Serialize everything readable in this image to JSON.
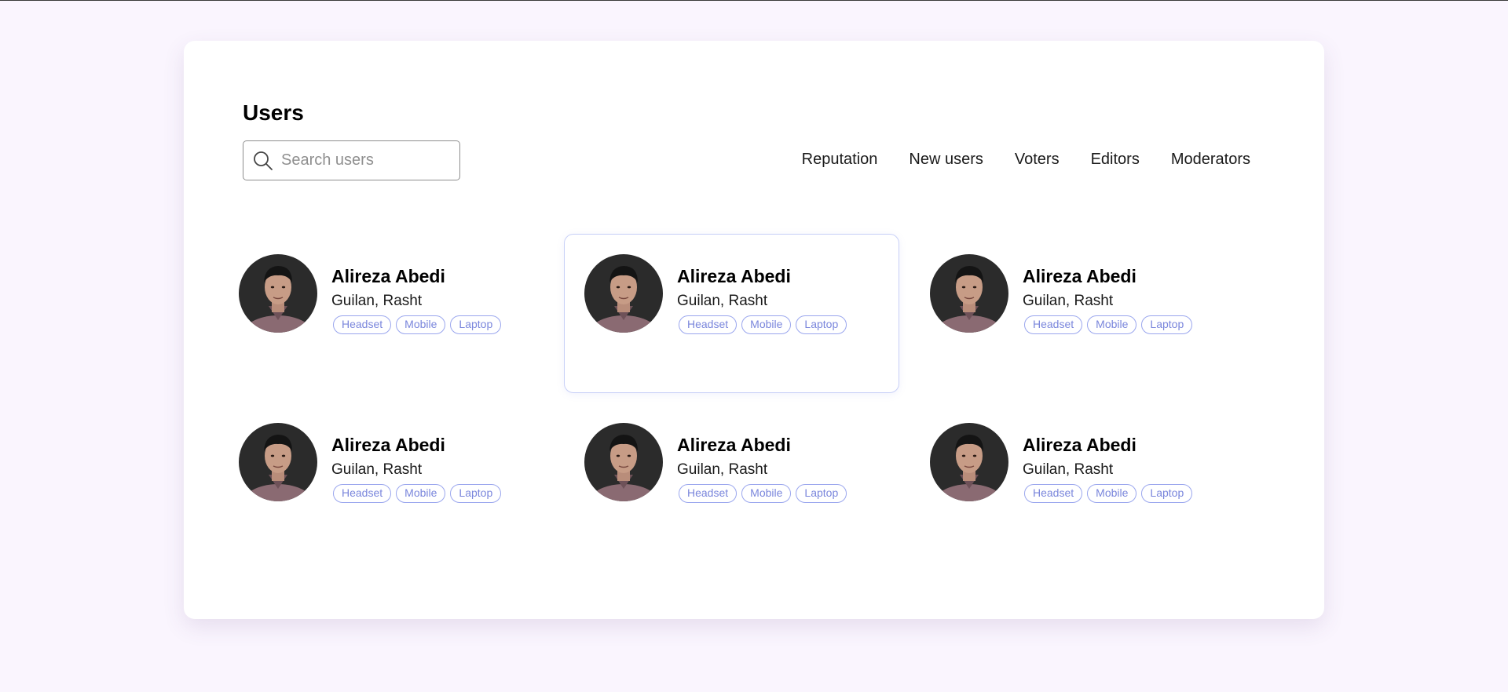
{
  "page": {
    "title": "Users"
  },
  "search": {
    "placeholder": "Search users",
    "value": "",
    "icon": "search-icon"
  },
  "filters": [
    {
      "label": "Reputation"
    },
    {
      "label": "New users"
    },
    {
      "label": "Voters"
    },
    {
      "label": "Editors"
    },
    {
      "label": "Moderators"
    }
  ],
  "colors": {
    "background": "#faf5fe",
    "panel": "#ffffff",
    "tag_border": "#9aa6ee",
    "tag_text": "#7a86dc",
    "highlight_border": "#c8d0f7"
  },
  "users": [
    {
      "name": "Alireza Abedi",
      "location": "Guilan, Rasht",
      "tags": [
        "Headset",
        "Mobile",
        "Laptop"
      ],
      "highlighted": false
    },
    {
      "name": "Alireza Abedi",
      "location": "Guilan, Rasht",
      "tags": [
        "Headset",
        "Mobile",
        "Laptop"
      ],
      "highlighted": true
    },
    {
      "name": "Alireza Abedi",
      "location": "Guilan, Rasht",
      "tags": [
        "Headset",
        "Mobile",
        "Laptop"
      ],
      "highlighted": false
    },
    {
      "name": "Alireza Abedi",
      "location": "Guilan, Rasht",
      "tags": [
        "Headset",
        "Mobile",
        "Laptop"
      ],
      "highlighted": false
    },
    {
      "name": "Alireza Abedi",
      "location": "Guilan, Rasht",
      "tags": [
        "Headset",
        "Mobile",
        "Laptop"
      ],
      "highlighted": false
    },
    {
      "name": "Alireza Abedi",
      "location": "Guilan, Rasht",
      "tags": [
        "Headset",
        "Mobile",
        "Laptop"
      ],
      "highlighted": false
    }
  ]
}
